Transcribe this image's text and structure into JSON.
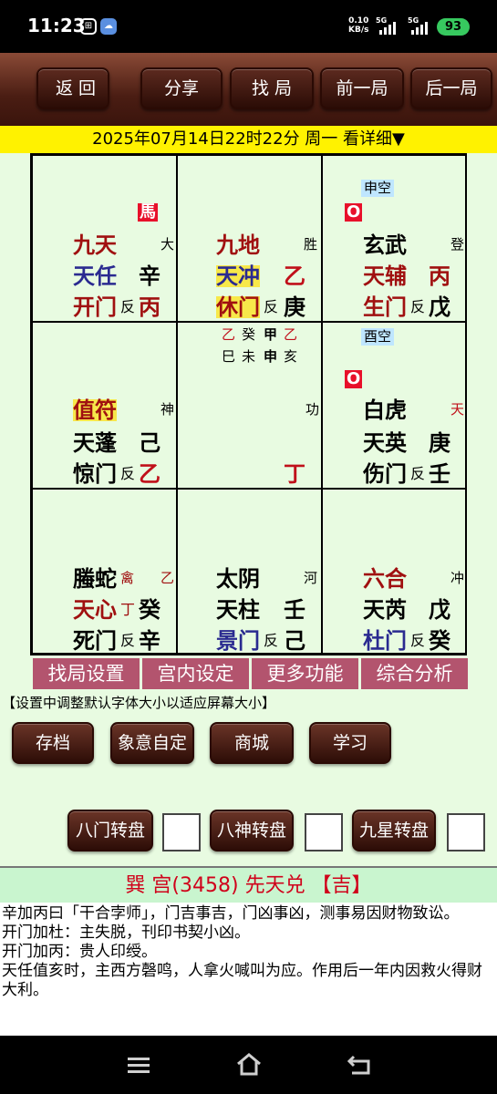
{
  "status": {
    "time": "11:23",
    "net_speed": "0.10",
    "net_unit": "KB/s",
    "sig1": "5G",
    "sig2": "5G",
    "battery": "93"
  },
  "toolbar": {
    "back": "返 回",
    "share": "分享",
    "find": "找 局",
    "prev": "前一局",
    "next": "后一局"
  },
  "datebar": "2025年07月14日22时22分 周一 看详细▼",
  "grid": {
    "c1": {
      "horse": "馬",
      "god": "九天",
      "god_side": "大",
      "star": "天任",
      "star_stem": "辛",
      "door": "开门",
      "fan": "反",
      "door_stem": "丙"
    },
    "c2": {
      "god": "九地",
      "god_side": "胜",
      "star": "天冲",
      "star_stem": "乙",
      "door": "休门",
      "fan": "反",
      "door_stem": "庚"
    },
    "c3": {
      "kong": "申空",
      "mark": "O",
      "god": "玄武",
      "god_side": "登",
      "star": "天辅",
      "star_stem": "丙",
      "door": "生门",
      "fan": "反",
      "door_stem": "戊"
    },
    "c4": {
      "god": "值符",
      "god_side": "神",
      "star": "天蓬",
      "star_stem": "己",
      "door": "惊门",
      "fan": "反",
      "door_stem": "乙"
    },
    "c5": {
      "g1": "乙",
      "g2": "癸",
      "g3": "甲",
      "g4": "乙",
      "b1": "巳",
      "b2": "未",
      "b3": "申",
      "b4": "亥",
      "side": "功",
      "stem": "丁"
    },
    "c6": {
      "kong": "酉空",
      "mark": "O",
      "god": "白虎",
      "god_side": "天",
      "star": "天英",
      "star_stem": "庚",
      "door": "伤门",
      "fan": "反",
      "door_stem": "壬"
    },
    "c7": {
      "god": "螣蛇",
      "god_side": "禽",
      "god_stem": "乙",
      "star": "天心",
      "star_small": "丁",
      "star_stem": "癸",
      "door": "死门",
      "fan": "反",
      "door_stem": "辛"
    },
    "c8": {
      "god": "太阴",
      "god_side": "河",
      "star": "天柱",
      "star_stem": "壬",
      "door": "景门",
      "fan": "反",
      "door_stem": "己"
    },
    "c9": {
      "god": "六合",
      "god_side": "冲",
      "star": "天芮",
      "star_stem": "戊",
      "door": "杜门",
      "fan": "反",
      "door_stem": "癸"
    }
  },
  "tabs": [
    "找局设置",
    "宫内设定",
    "更多功能",
    "综合分析"
  ],
  "hint": "【设置中调整默认字体大小以适应屏幕大小】",
  "row_buttons": [
    "存档",
    "象意自定",
    "商城",
    "学习"
  ],
  "rotate_buttons": [
    "八门转盘",
    "八神转盘",
    "九星转盘"
  ],
  "panel": {
    "title": "巽 宫(3458) 先天兑 【吉】",
    "lines": [
      "辛加丙曰「干合孛师」，门吉事吉，门凶事凶，测事易因财物致讼。",
      "开门加杜：主失脱，刊印书契小凶。",
      "开门加丙：贵人印绶。",
      "天任值亥时，主西方磬鸣，人拿火喊叫为应。作用后一年内因救火得财大利。"
    ]
  }
}
